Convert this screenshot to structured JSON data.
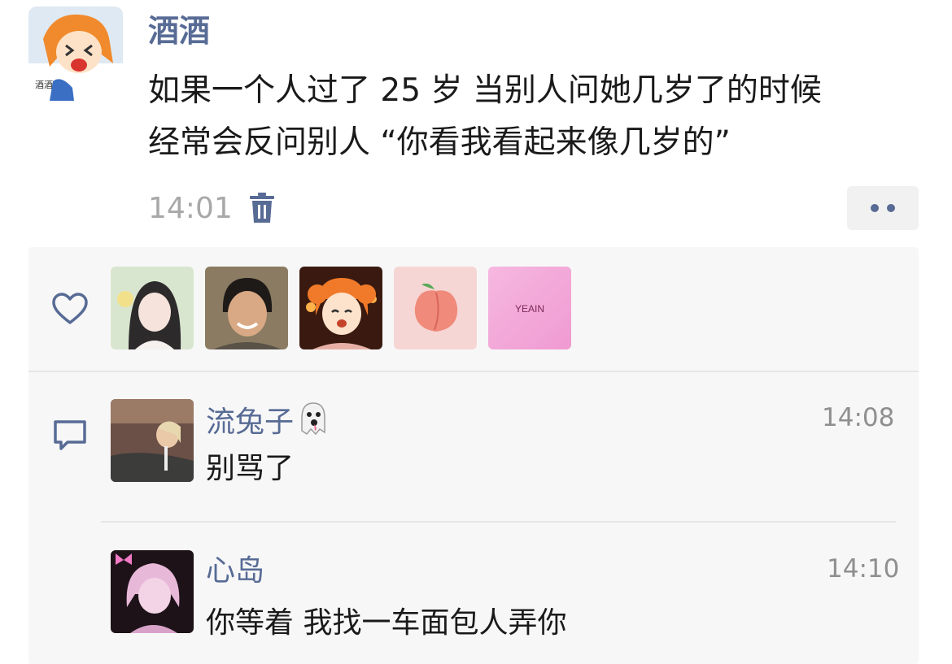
{
  "post": {
    "author": "酒酒",
    "text_lines": [
      "如果一个人过了 25 岁 当别人问她几岁了的时候",
      "经常会反问别人 “你看我看起来像几岁的”"
    ],
    "time": "14:01",
    "delete_icon": "trash-icon",
    "more_icon": "more-dots-icon"
  },
  "likes": {
    "icon": "heart-icon",
    "avatars": [
      {
        "name": "like-avatar-1"
      },
      {
        "name": "like-avatar-2"
      },
      {
        "name": "like-avatar-3"
      },
      {
        "name": "like-avatar-4"
      },
      {
        "name": "like-avatar-5",
        "text": "YEAIN"
      }
    ]
  },
  "comments": {
    "icon": "comment-icon",
    "items": [
      {
        "author": "流兔子",
        "emoji": "ghost-emoji",
        "text": "别骂了",
        "time": "14:08"
      },
      {
        "author": "心岛",
        "text": "你等着 我找一车面包人弄你",
        "time": "14:10"
      }
    ]
  },
  "colors": {
    "name_blue": "#576b95",
    "text": "#1a1a1a",
    "meta_gray": "#a8a8a8",
    "panel_bg": "#f7f7f7"
  }
}
